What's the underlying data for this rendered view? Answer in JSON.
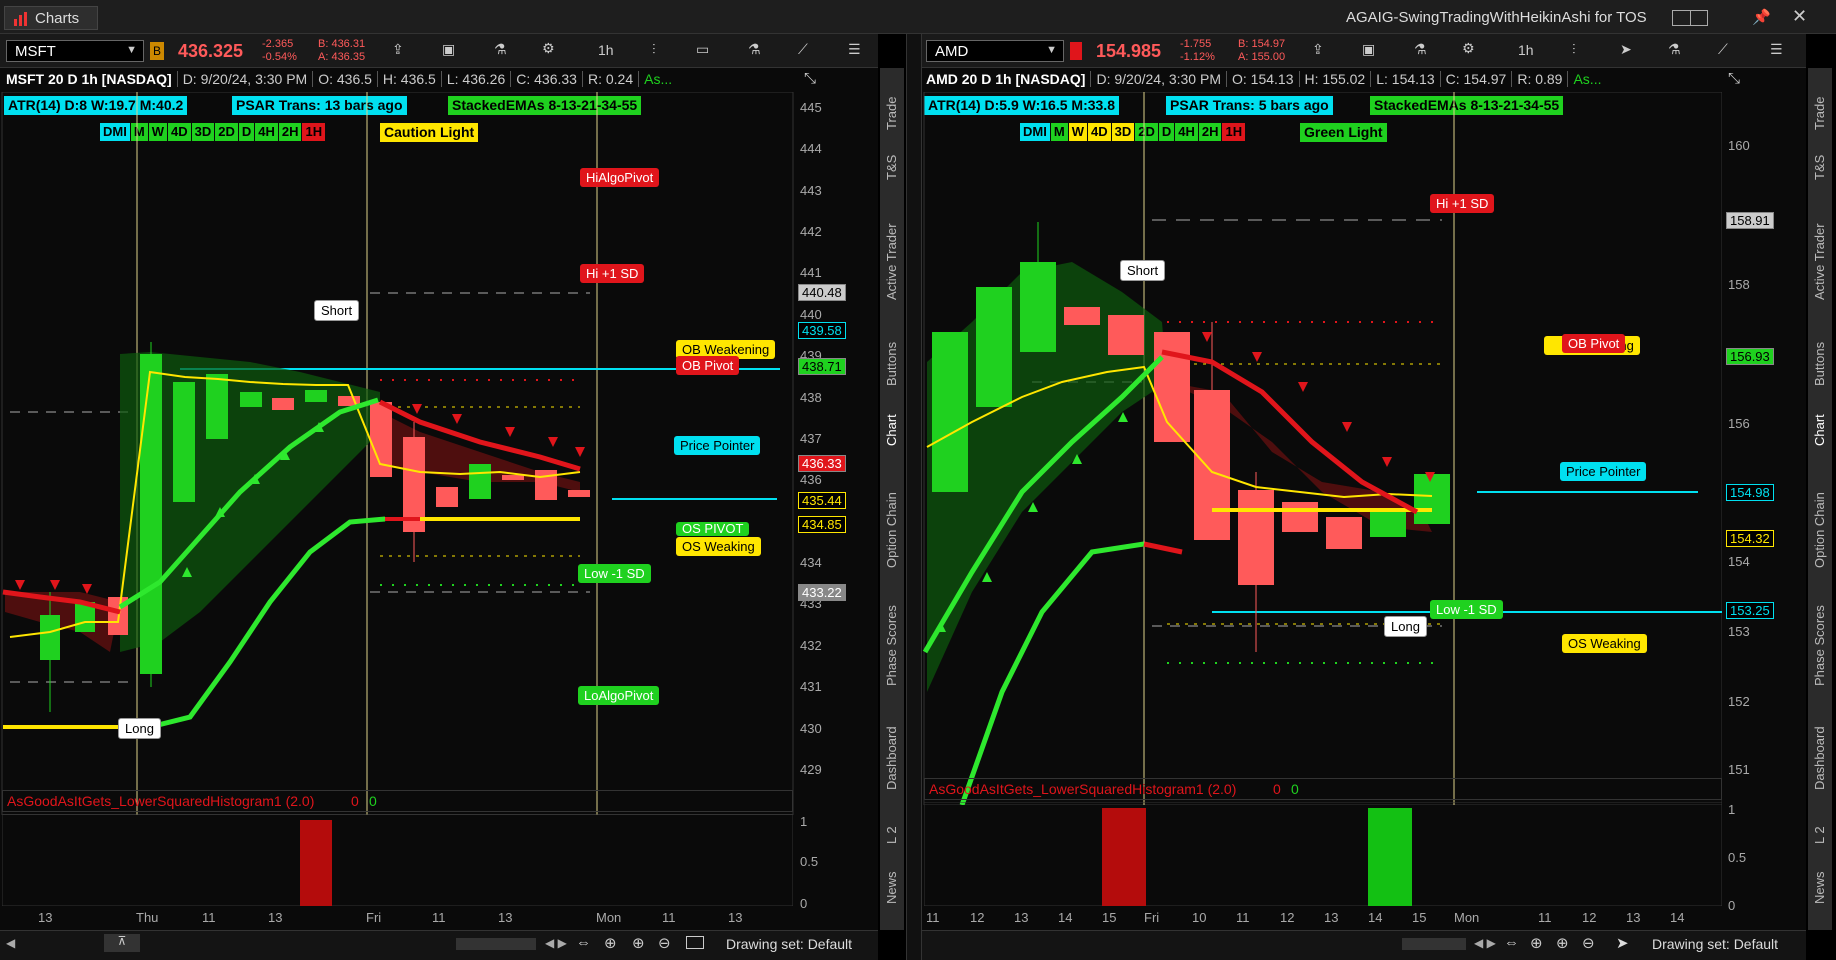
{
  "app": {
    "tab_title": "Charts",
    "window_title": "AGAIG-SwingTradingWithHeikinAshi for TOS"
  },
  "left": {
    "symbol": "MSFT",
    "price": "436.325",
    "change": "-2.365",
    "change_pct": "-0.54%",
    "bid": "B: 436.31",
    "ask": "A: 436.35",
    "timeframe": "1h",
    "header": {
      "title": "MSFT 20 D 1h [NASDAQ]",
      "date": "D: 9/20/24, 3:30 PM",
      "open": "O: 436.5",
      "high": "H: 436.5",
      "low": "L: 436.26",
      "close": "C: 436.33",
      "range": "R: 0.24",
      "as": "As..."
    },
    "atr": "ATR(14) D:8 W:19.7 M:40.2",
    "psar": "PSAR Trans: 13 bars ago",
    "stacked": "StackedEMAs 8-13-21-34-55",
    "light": "Caution Light",
    "tf_tags": [
      "DMI",
      "M",
      "W",
      "4D",
      "3D",
      "2D",
      "D",
      "4H",
      "2H",
      "1H"
    ],
    "labels": {
      "hi_algo": "HiAlgoPivot",
      "hi_sd": "Hi +1 SD",
      "short": "Short",
      "ob_weak": "OB Weakening",
      "ob_pivot": "OB Pivot",
      "price_pointer": "Price Pointer",
      "os_pivot": "OS PIVOT",
      "os_weak": "OS Weaking",
      "low_sd": "Low -1 SD",
      "lo_algo": "LoAlgoPivot",
      "long": "Long"
    },
    "axis": [
      "445",
      "444",
      "443",
      "442",
      "441",
      "440",
      "439",
      "438",
      "437",
      "436",
      "435",
      "434",
      "433",
      "432",
      "431",
      "430",
      "429"
    ],
    "price_tags": [
      "440.48",
      "439.58",
      "438.71",
      "436.33",
      "435.44",
      "434.85",
      "433.22"
    ],
    "histogram_title": "AsGoodAsItGets_LowerSquaredHistogram1 (2.0)",
    "hist_v1": "0",
    "hist_v2": "0",
    "hist_axis": [
      "1",
      "0.5",
      "0"
    ],
    "time_axis": [
      "13",
      "Thu",
      "11",
      "13",
      "Fri",
      "11",
      "13",
      "Mon",
      "11",
      "13"
    ],
    "drawing_set": "Drawing set: Default"
  },
  "right": {
    "symbol": "AMD",
    "price": "154.985",
    "change": "-1.755",
    "change_pct": "-1.12%",
    "bid": "B: 154.97",
    "ask": "A: 155.00",
    "timeframe": "1h",
    "header": {
      "title": "AMD 20 D 1h [NASDAQ]",
      "date": "D: 9/20/24, 3:30 PM",
      "open": "O: 154.13",
      "high": "H: 155.02",
      "low": "L: 154.13",
      "close": "C: 154.97",
      "range": "R: 0.89",
      "as": "As..."
    },
    "atr": "ATR(14) D:5.9 W:16.5 M:33.8",
    "psar": "PSAR Trans: 5 bars ago",
    "stacked": "StackedEMAs 8-13-21-34-55",
    "light": "Green Light",
    "tf_tags": [
      "DMI",
      "M",
      "W",
      "4D",
      "3D",
      "2D",
      "D",
      "4H",
      "2H",
      "1H"
    ],
    "labels": {
      "hi_sd": "Hi +1 SD",
      "short": "Short",
      "ob_pivot": "OB Pivot",
      "ob_weak": "ening",
      "price_pointer": "Price Pointer",
      "low_sd": "Low -1 SD",
      "long": "Long",
      "os_weak": "OS Weaking"
    },
    "axis": [
      "160",
      "158",
      "156",
      "154",
      "153",
      "152",
      "151"
    ],
    "price_tags": [
      "158.91",
      "156.93",
      "154.98",
      "154.32",
      "153.25"
    ],
    "histogram_title": "AsGoodAsItGets_LowerSquaredHistogram1 (2.0)",
    "hist_v1": "0",
    "hist_v2": "0",
    "hist_axis": [
      "1",
      "0.5",
      "0"
    ],
    "time_axis": [
      "11",
      "12",
      "13",
      "14",
      "15",
      "Fri",
      "10",
      "11",
      "12",
      "13",
      "14",
      "15",
      "Mon",
      "11",
      "12",
      "13",
      "14"
    ],
    "drawing_set": "Drawing set: Default"
  },
  "side_tabs": [
    "Trade",
    "T&S",
    "Active Trader",
    "Buttons",
    "Chart",
    "Option Chain",
    "Phase Scores",
    "Dashboard",
    "L 2",
    "News"
  ],
  "colors": {
    "bull": "#1fd11f",
    "bear": "#ff5a5a",
    "cyan": "#00e0f0",
    "yellow": "#ffe600",
    "panel_bg": "#0a0a0a"
  }
}
